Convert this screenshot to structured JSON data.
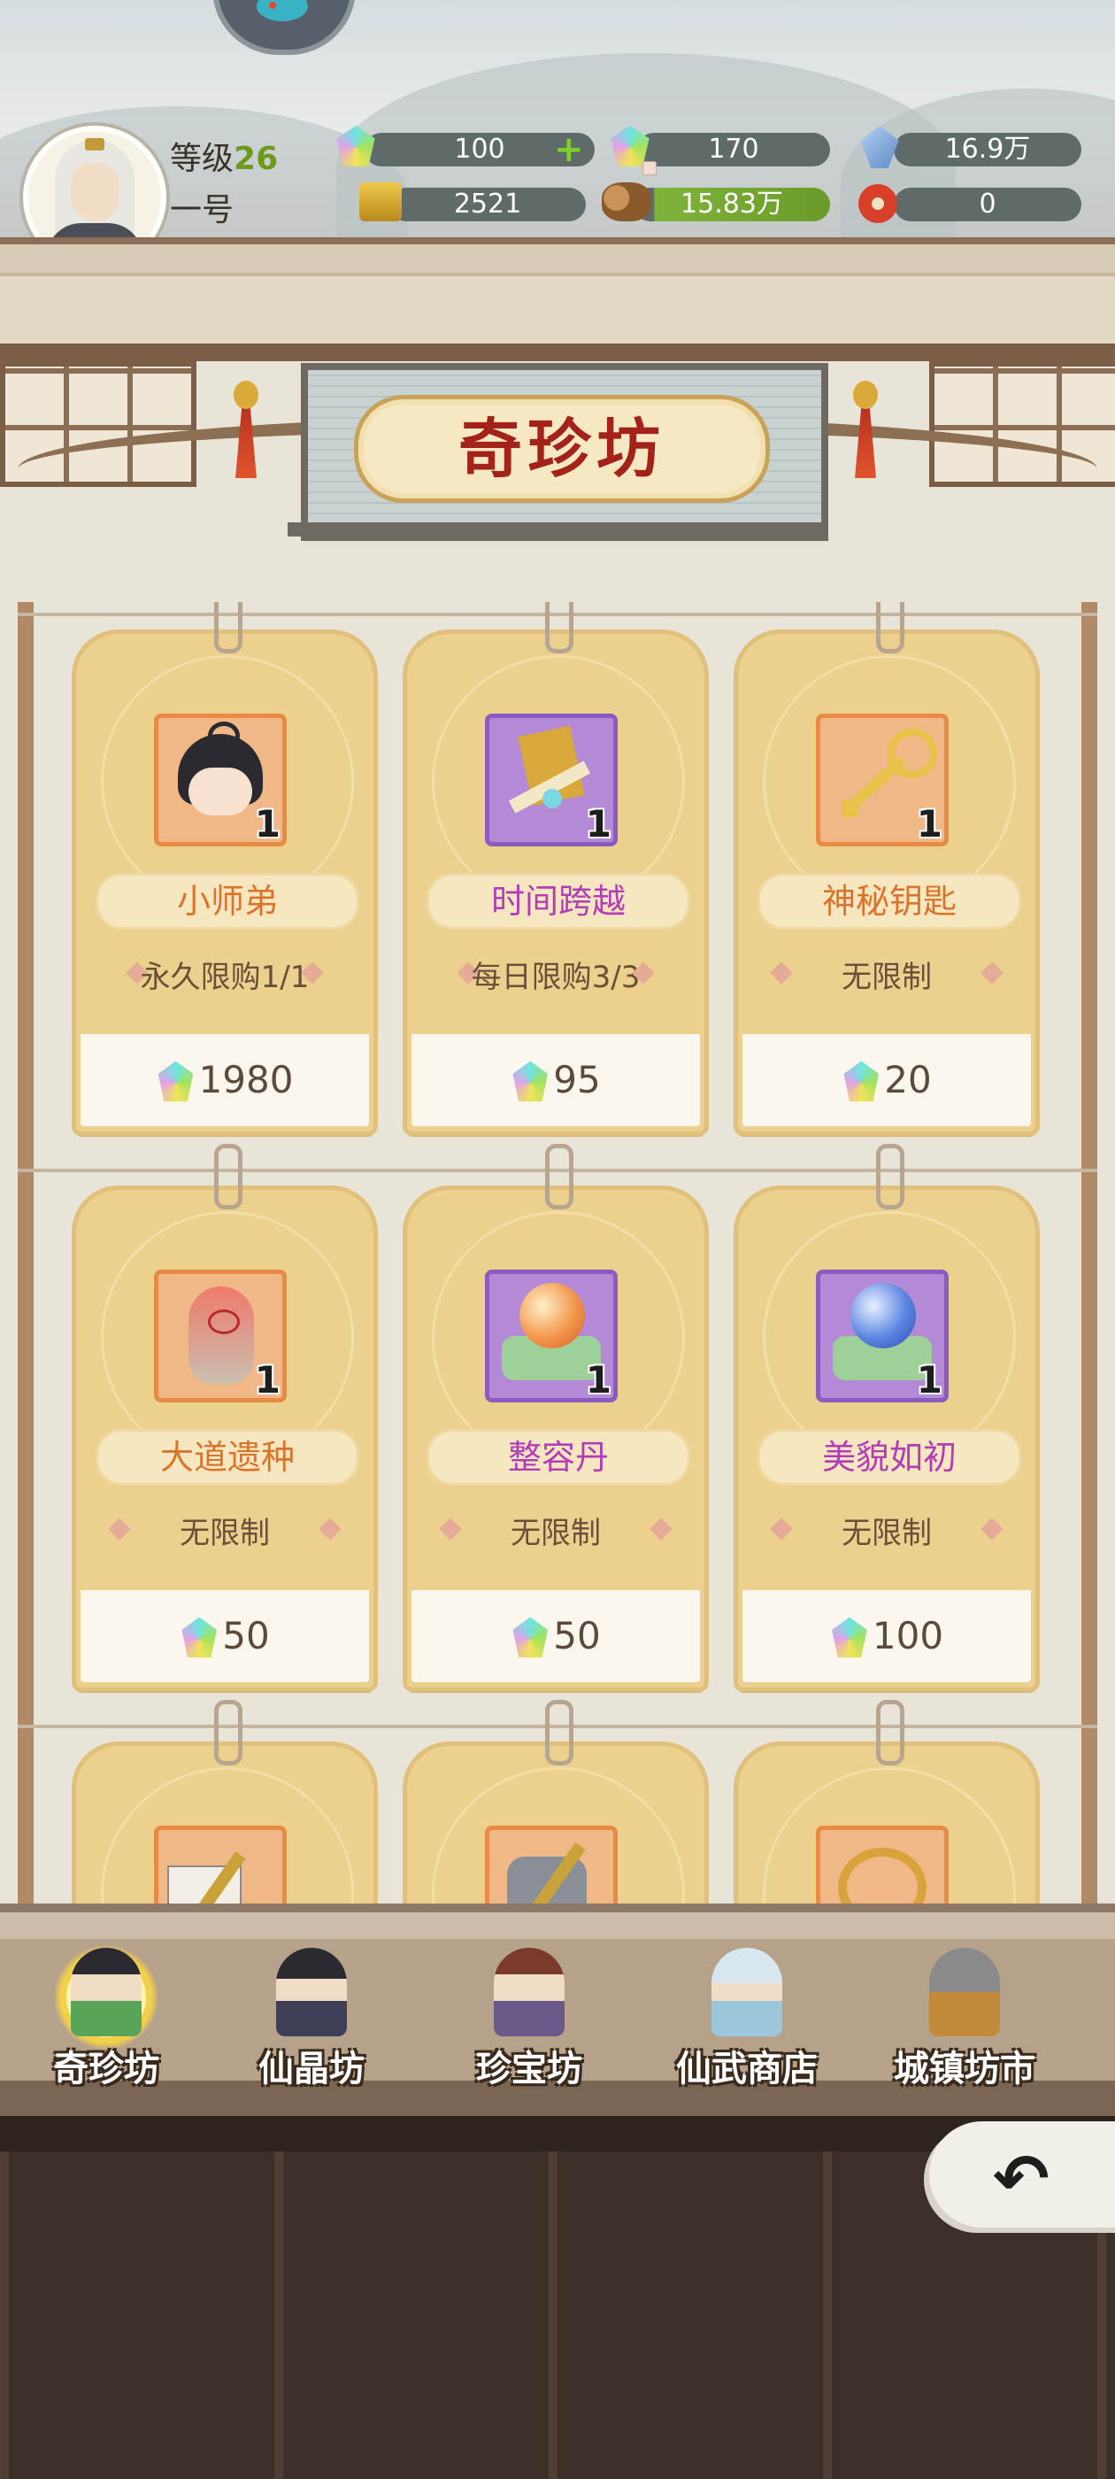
{
  "player": {
    "level_label": "等级",
    "level": "26",
    "name": "一号"
  },
  "resources": [
    {
      "icon": "spirit-gem-icon",
      "value": "100",
      "has_plus": true
    },
    {
      "icon": "rainbow-gem-icon",
      "value": "170"
    },
    {
      "icon": "blue-crystal-icon",
      "value": "16.9万"
    },
    {
      "icon": "gold-ingot-icon",
      "value": "2521"
    },
    {
      "icon": "wood-log-icon",
      "value": "15.83万"
    },
    {
      "icon": "red-token-icon",
      "value": "0"
    }
  ],
  "shop": {
    "title": "奇珍坊",
    "items": [
      {
        "name": "小师弟",
        "qty": "1",
        "limit": "永久限购1/1",
        "price": "1980",
        "rarity": "orange",
        "icon": "junior-disciple-icon"
      },
      {
        "name": "时间跨越",
        "qty": "1",
        "limit": "每日限购3/3",
        "price": "95",
        "rarity": "purple",
        "icon": "time-scroll-icon"
      },
      {
        "name": "神秘钥匙",
        "qty": "1",
        "limit": "无限制",
        "price": "20",
        "rarity": "orange",
        "icon": "mystery-key-icon"
      },
      {
        "name": "大道遗种",
        "qty": "1",
        "limit": "无限制",
        "price": "50",
        "rarity": "orange",
        "icon": "dao-seed-icon"
      },
      {
        "name": "整容丹",
        "qty": "1",
        "limit": "无限制",
        "price": "50",
        "rarity": "purple",
        "icon": "orange-pill-icon"
      },
      {
        "name": "美貌如初",
        "qty": "1",
        "limit": "无限制",
        "price": "100",
        "rarity": "purple",
        "icon": "blue-pill-icon"
      }
    ]
  },
  "nav": [
    {
      "label": "奇珍坊",
      "active": true
    },
    {
      "label": "仙晶坊"
    },
    {
      "label": "珍宝坊"
    },
    {
      "label": "仙武商店"
    },
    {
      "label": "城镇坊市"
    }
  ],
  "colors": {
    "orange_rarity": "#e98a44",
    "purple_rarity": "#8b5cc0",
    "title_red": "#a3231b",
    "level_green": "#6b9a1c"
  }
}
